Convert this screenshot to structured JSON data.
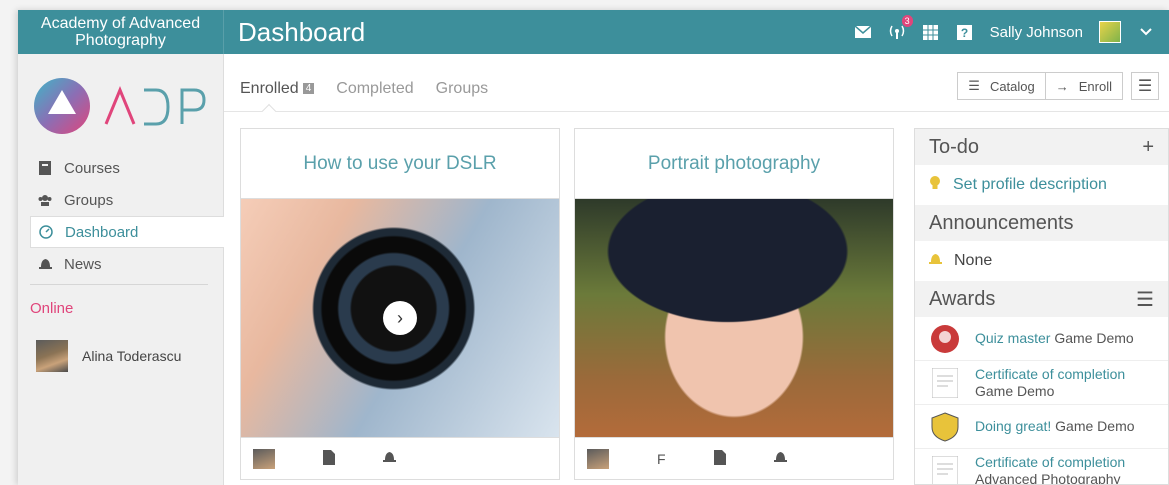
{
  "header": {
    "brand": "Academy of Advanced Photography",
    "title": "Dashboard",
    "notification_count": "3",
    "user_name": "Sally Johnson"
  },
  "sidebar": {
    "logo_text": "ADP",
    "items": [
      {
        "label": "Courses",
        "icon": "book-icon"
      },
      {
        "label": "Groups",
        "icon": "users-icon"
      },
      {
        "label": "Dashboard",
        "icon": "dashboard-icon"
      },
      {
        "label": "News",
        "icon": "bell-icon"
      }
    ],
    "online_title": "Online",
    "online_users": [
      {
        "name": "Alina Toderascu"
      }
    ]
  },
  "tabs": [
    {
      "label": "Enrolled",
      "count": "4"
    },
    {
      "label": "Completed"
    },
    {
      "label": "Groups"
    }
  ],
  "toolbar": {
    "catalog_label": "Catalog",
    "enroll_label": "Enroll"
  },
  "courses": [
    {
      "title": "How to use your DSLR"
    },
    {
      "title": "Portrait photography",
      "footer_letter": "F"
    }
  ],
  "todo": {
    "title": "To-do",
    "items": [
      "Set profile description"
    ]
  },
  "announcements": {
    "title": "Announcements",
    "value": "None"
  },
  "awards": {
    "title": "Awards",
    "items": [
      {
        "name": "Quiz master",
        "course": "Game Demo"
      },
      {
        "name": "Certificate of completion",
        "course": "Game Demo"
      },
      {
        "name": "Doing great!",
        "course": "Game Demo"
      },
      {
        "name": "Certificate of completion",
        "course": "Advanced Photography"
      }
    ]
  },
  "colors": {
    "accent": "#3d8f9b",
    "online": "#e0457b",
    "badge": "#e0457b"
  }
}
